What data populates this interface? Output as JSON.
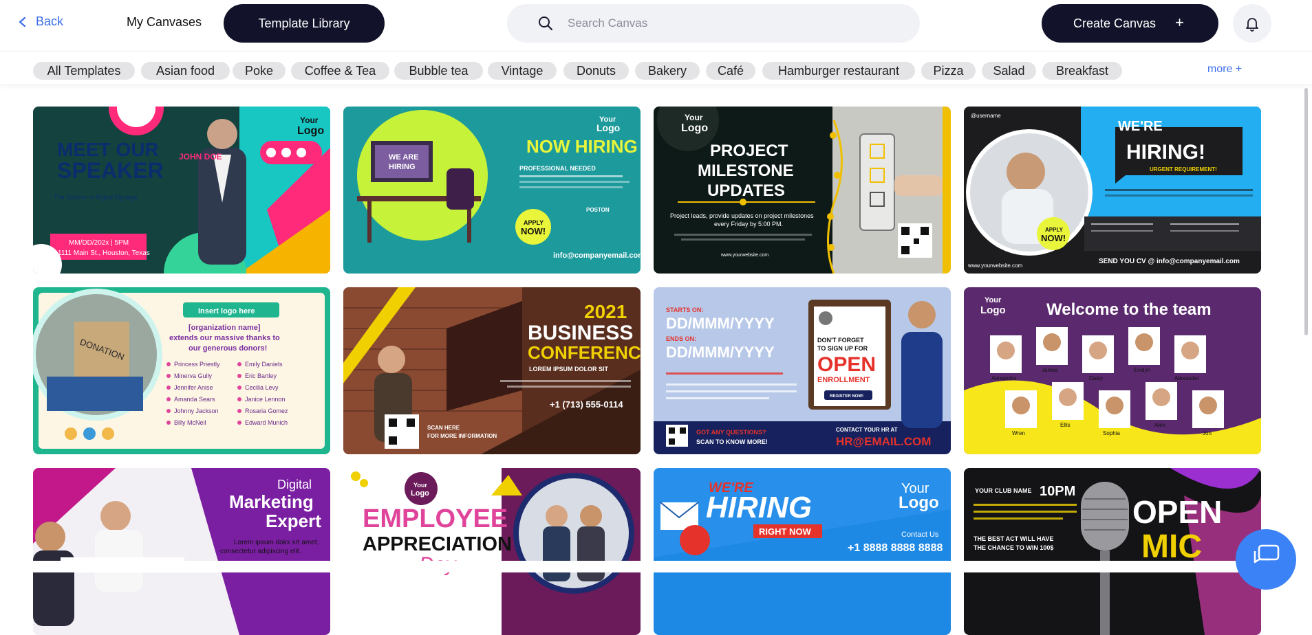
{
  "header": {
    "back_label": "Back",
    "my_canvases_label": "My Canvases",
    "template_library_label": "Template Library",
    "search_placeholder": "Search Canvas",
    "create_canvas_label": "Create Canvas",
    "create_canvas_icon": "+"
  },
  "filters": {
    "chips": [
      "All Templates",
      "Asian food",
      "Poke",
      "Coffee & Tea",
      "Bubble tea",
      "Vintage",
      "Donuts",
      "Bakery",
      "Café",
      "Hamburger restaurant",
      "Pizza",
      "Salad",
      "Breakfast"
    ],
    "more_label": "more +"
  },
  "templates": [
    {
      "lines": [
        "MEET OUR",
        "SPEAKER",
        "JOHN DOE",
        "MM/DD/202x | 5PM",
        "1111 Main St., Houston, Texas",
        "Your",
        "Logo",
        "The Sunrise of Digital Signage"
      ]
    },
    {
      "lines": [
        "NOW HIRING",
        "PROFESSIONAL NEEDED",
        "WE ARE",
        "HIRING",
        "APPLY",
        "NOW!",
        "POSTON",
        "info@companyemail.com",
        "Your",
        "Logo"
      ]
    },
    {
      "lines": [
        "PROJECT",
        "MILESTONE",
        "UPDATES",
        "Project leads, provide updates on project milestones",
        "every Friday by 5:00 PM.",
        "www.yourwebsite.com",
        "Your",
        "Logo"
      ]
    },
    {
      "lines": [
        "WE'RE",
        "HIRING!",
        "URGENT REQUIREMENT!",
        "APPLY",
        "NOW!",
        "SEND YOU CV @ info@companyemail.com",
        "www.yourwebsite.com",
        "@username"
      ]
    },
    {
      "lines": [
        "Insert logo here",
        "[organization name]",
        "extends our massive thanks to",
        "our generous donors!",
        "Princess Priestly",
        "Minerva Gully",
        "Jennifer Anise",
        "Amanda Sears",
        "Johnny Jackson",
        "Billy McNeil",
        "Emily Daniels",
        "Eric Bartley",
        "Cecilia Levy",
        "Janice Lennon",
        "Rosaria Gomez",
        "Edward Munich",
        "DONATION"
      ]
    },
    {
      "lines": [
        "2021",
        "BUSINESS",
        "CONFERENCE",
        "LOREM IPSUM DOLOR SIT",
        "+1 (713) 555-0114",
        "SCAN HERE",
        "FOR MORE INFORMATION"
      ]
    },
    {
      "lines": [
        "STARTS ON:",
        "DD/MMM/YYYY",
        "ENDS ON:",
        "DD/MMM/YYYY",
        "DON'T FORGET",
        "TO SIGN UP FOR",
        "OPEN",
        "ENROLLMENT",
        "REGISTER NOW!",
        "GOT ANY QUESTIONS?",
        "SCAN TO KNOW MORE!",
        "CONTACT YOUR HR AT",
        "HR@EMAIL.COM"
      ]
    },
    {
      "lines": [
        "Welcome to the team",
        "Your",
        "Logo",
        "Alexandra",
        "James",
        "Daisy",
        "Evelyn",
        "Alexander",
        "Wren",
        "Ellis",
        "Sophia",
        "Alex",
        "Jon"
      ]
    },
    {
      "lines": [
        "Digital",
        "Marketing",
        "Expert",
        "Lorem ipsum dokx srt amet,",
        "consectetur adipiscing elit."
      ]
    },
    {
      "lines": [
        "EMPLOYEE",
        "APPRECIATION",
        "Day",
        "Your",
        "Logo"
      ]
    },
    {
      "lines": [
        "WE'RE",
        "HIRING",
        "RIGHT NOW",
        "Your",
        "Logo",
        "Contact Us",
        "+1 8888 8888 8888"
      ]
    },
    {
      "lines": [
        "YOUR CLUB NAME",
        "10PM",
        "OPEN",
        "MIC",
        "THE BEST ACT WILL HAVE",
        "THE CHANCE TO WIN 100$"
      ]
    }
  ],
  "colors": {
    "accent": "#3b6ee8",
    "dark": "#12122a",
    "chip_bg": "#e4e4e6",
    "search_bg": "#f1f2f6",
    "fab": "#3b82f6"
  },
  "icons": {
    "back": "chevron-left-icon",
    "search": "search-icon",
    "plus": "plus-icon",
    "bell": "bell-icon",
    "chat": "chat-icon"
  }
}
